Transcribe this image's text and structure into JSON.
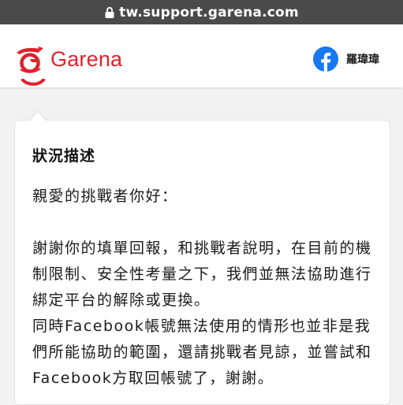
{
  "browser": {
    "url": "tw.support.garena.com"
  },
  "header": {
    "brand": "Garena",
    "user_name": "羅瑋瑋"
  },
  "colors": {
    "brand_red": "#e3202d",
    "facebook_blue": "#1877f2"
  },
  "icons": {
    "lock": "lock-icon",
    "logo": "garena-logo-icon",
    "facebook": "facebook-icon"
  },
  "card": {
    "title": "狀況描述",
    "greeting": "親愛的挑戰者你好：",
    "paragraph_1": "謝謝你的填單回報，和挑戰者說明，在目前的機制限制、安全性考量之下，我們並無法協助進行綁定平台的解除或更換。",
    "paragraph_2": "同時Facebook帳號無法使用的情形也並非是我們所能協助的範圍，還請挑戰者見諒，並嘗試和Facebook方取回帳號了，謝謝。"
  }
}
